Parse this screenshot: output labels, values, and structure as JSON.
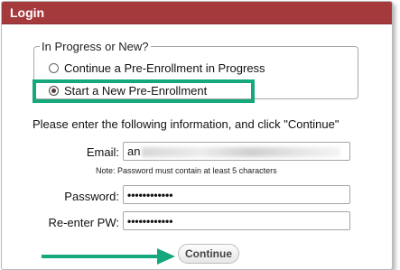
{
  "window": {
    "title": "Login"
  },
  "progress_group": {
    "legend": "In Progress or New?",
    "options": [
      {
        "label": "Continue a Pre-Enrollment in Progress",
        "selected": false
      },
      {
        "label": "Start a New Pre-Enrollment",
        "selected": true
      }
    ]
  },
  "form": {
    "instruction": "Please enter the following information, and click \"Continue\"",
    "email_label": "Email:",
    "email_value": "an",
    "password_note": "Note: Password must contain at least 5 characters",
    "password_label": "Password:",
    "password_value": "••••••••••••",
    "reenter_label": "Re-enter PW:",
    "reenter_value": "••••••••••••",
    "continue_label": "Continue"
  },
  "colors": {
    "titlebar": "#a53a3d",
    "highlight": "#15a87c",
    "arrow": "#15a87c"
  },
  "icons": {
    "arrow": "right-arrow-icon"
  }
}
